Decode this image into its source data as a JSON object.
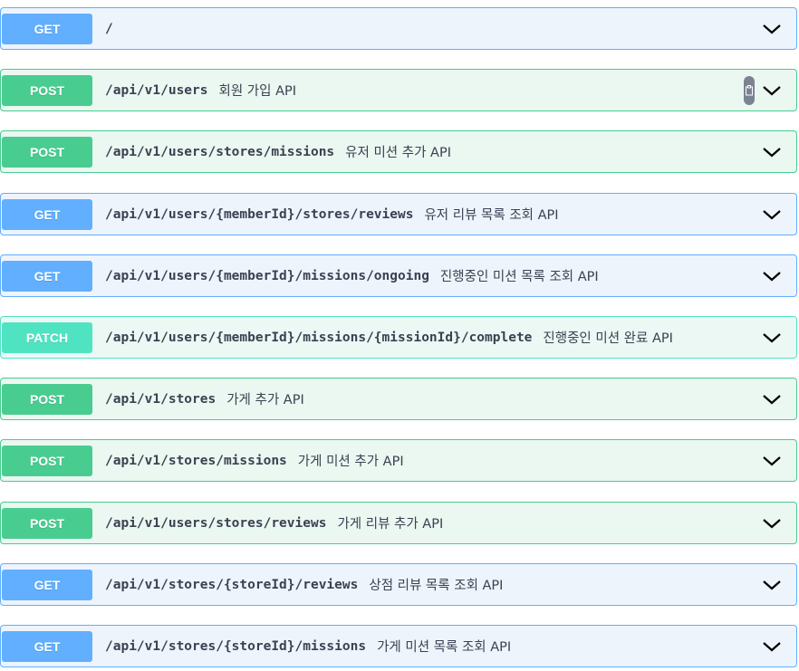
{
  "operations": [
    {
      "method": "GET",
      "path": "/",
      "summary": ""
    },
    {
      "method": "POST",
      "path": "/api/v1/users",
      "summary": "회원 가입 API"
    },
    {
      "method": "POST",
      "path": "/api/v1/users/stores/missions",
      "summary": "유저 미션 추가 API"
    },
    {
      "method": "GET",
      "path": "/api/v1/users/{memberId}/stores/reviews",
      "summary": "유저 리뷰 목록 조회 API"
    },
    {
      "method": "GET",
      "path": "/api/v1/users/{memberId}/missions/ongoing",
      "summary": "진행중인 미션 목록 조회 API"
    },
    {
      "method": "PATCH",
      "path": "/api/v1/users/{memberId}/missions/{missionId}/complete",
      "summary": "진행중인 미션 완료 API"
    },
    {
      "method": "POST",
      "path": "/api/v1/stores",
      "summary": "가게 추가 API"
    },
    {
      "method": "POST",
      "path": "/api/v1/stores/missions",
      "summary": "가게 미션 추가 API"
    },
    {
      "method": "POST",
      "path": "/api/v1/users/stores/reviews",
      "summary": "가게 리뷰 추가 API"
    },
    {
      "method": "GET",
      "path": "/api/v1/stores/{storeId}/reviews",
      "summary": "상점 리뷰 목록 조회 API"
    },
    {
      "method": "GET",
      "path": "/api/v1/stores/{storeId}/missions",
      "summary": "가게 미션 목록 조회 API"
    }
  ],
  "colors": {
    "get": "#61affe",
    "post": "#49cc90",
    "patch": "#50e3c2",
    "text": "#3b4151"
  },
  "icons": {
    "expand": "chevron-down-icon",
    "copy": "copy-icon"
  }
}
